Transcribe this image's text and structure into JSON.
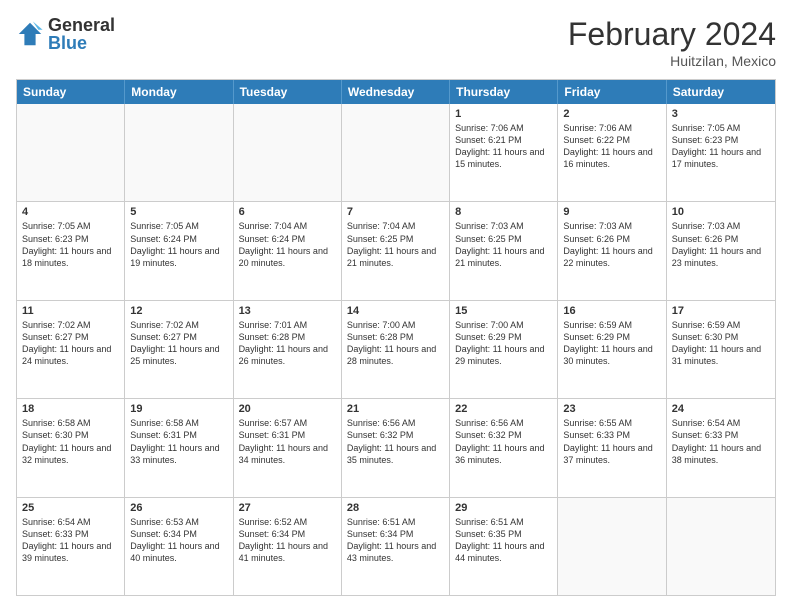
{
  "logo": {
    "general": "General",
    "blue": "Blue"
  },
  "title": {
    "month_year": "February 2024",
    "location": "Huitzilan, Mexico"
  },
  "header_days": [
    "Sunday",
    "Monday",
    "Tuesday",
    "Wednesday",
    "Thursday",
    "Friday",
    "Saturday"
  ],
  "weeks": [
    [
      {
        "day": "",
        "info": ""
      },
      {
        "day": "",
        "info": ""
      },
      {
        "day": "",
        "info": ""
      },
      {
        "day": "",
        "info": ""
      },
      {
        "day": "1",
        "info": "Sunrise: 7:06 AM\nSunset: 6:21 PM\nDaylight: 11 hours and 15 minutes."
      },
      {
        "day": "2",
        "info": "Sunrise: 7:06 AM\nSunset: 6:22 PM\nDaylight: 11 hours and 16 minutes."
      },
      {
        "day": "3",
        "info": "Sunrise: 7:05 AM\nSunset: 6:23 PM\nDaylight: 11 hours and 17 minutes."
      }
    ],
    [
      {
        "day": "4",
        "info": "Sunrise: 7:05 AM\nSunset: 6:23 PM\nDaylight: 11 hours and 18 minutes."
      },
      {
        "day": "5",
        "info": "Sunrise: 7:05 AM\nSunset: 6:24 PM\nDaylight: 11 hours and 19 minutes."
      },
      {
        "day": "6",
        "info": "Sunrise: 7:04 AM\nSunset: 6:24 PM\nDaylight: 11 hours and 20 minutes."
      },
      {
        "day": "7",
        "info": "Sunrise: 7:04 AM\nSunset: 6:25 PM\nDaylight: 11 hours and 21 minutes."
      },
      {
        "day": "8",
        "info": "Sunrise: 7:03 AM\nSunset: 6:25 PM\nDaylight: 11 hours and 21 minutes."
      },
      {
        "day": "9",
        "info": "Sunrise: 7:03 AM\nSunset: 6:26 PM\nDaylight: 11 hours and 22 minutes."
      },
      {
        "day": "10",
        "info": "Sunrise: 7:03 AM\nSunset: 6:26 PM\nDaylight: 11 hours and 23 minutes."
      }
    ],
    [
      {
        "day": "11",
        "info": "Sunrise: 7:02 AM\nSunset: 6:27 PM\nDaylight: 11 hours and 24 minutes."
      },
      {
        "day": "12",
        "info": "Sunrise: 7:02 AM\nSunset: 6:27 PM\nDaylight: 11 hours and 25 minutes."
      },
      {
        "day": "13",
        "info": "Sunrise: 7:01 AM\nSunset: 6:28 PM\nDaylight: 11 hours and 26 minutes."
      },
      {
        "day": "14",
        "info": "Sunrise: 7:00 AM\nSunset: 6:28 PM\nDaylight: 11 hours and 28 minutes."
      },
      {
        "day": "15",
        "info": "Sunrise: 7:00 AM\nSunset: 6:29 PM\nDaylight: 11 hours and 29 minutes."
      },
      {
        "day": "16",
        "info": "Sunrise: 6:59 AM\nSunset: 6:29 PM\nDaylight: 11 hours and 30 minutes."
      },
      {
        "day": "17",
        "info": "Sunrise: 6:59 AM\nSunset: 6:30 PM\nDaylight: 11 hours and 31 minutes."
      }
    ],
    [
      {
        "day": "18",
        "info": "Sunrise: 6:58 AM\nSunset: 6:30 PM\nDaylight: 11 hours and 32 minutes."
      },
      {
        "day": "19",
        "info": "Sunrise: 6:58 AM\nSunset: 6:31 PM\nDaylight: 11 hours and 33 minutes."
      },
      {
        "day": "20",
        "info": "Sunrise: 6:57 AM\nSunset: 6:31 PM\nDaylight: 11 hours and 34 minutes."
      },
      {
        "day": "21",
        "info": "Sunrise: 6:56 AM\nSunset: 6:32 PM\nDaylight: 11 hours and 35 minutes."
      },
      {
        "day": "22",
        "info": "Sunrise: 6:56 AM\nSunset: 6:32 PM\nDaylight: 11 hours and 36 minutes."
      },
      {
        "day": "23",
        "info": "Sunrise: 6:55 AM\nSunset: 6:33 PM\nDaylight: 11 hours and 37 minutes."
      },
      {
        "day": "24",
        "info": "Sunrise: 6:54 AM\nSunset: 6:33 PM\nDaylight: 11 hours and 38 minutes."
      }
    ],
    [
      {
        "day": "25",
        "info": "Sunrise: 6:54 AM\nSunset: 6:33 PM\nDaylight: 11 hours and 39 minutes."
      },
      {
        "day": "26",
        "info": "Sunrise: 6:53 AM\nSunset: 6:34 PM\nDaylight: 11 hours and 40 minutes."
      },
      {
        "day": "27",
        "info": "Sunrise: 6:52 AM\nSunset: 6:34 PM\nDaylight: 11 hours and 41 minutes."
      },
      {
        "day": "28",
        "info": "Sunrise: 6:51 AM\nSunset: 6:34 PM\nDaylight: 11 hours and 43 minutes."
      },
      {
        "day": "29",
        "info": "Sunrise: 6:51 AM\nSunset: 6:35 PM\nDaylight: 11 hours and 44 minutes."
      },
      {
        "day": "",
        "info": ""
      },
      {
        "day": "",
        "info": ""
      }
    ]
  ]
}
